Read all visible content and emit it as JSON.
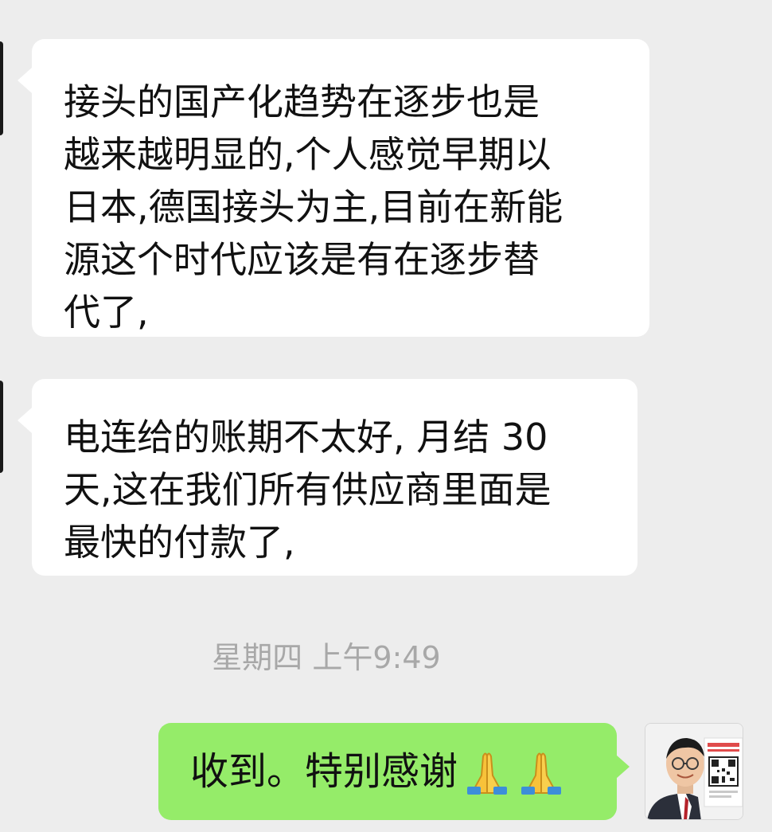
{
  "chat": {
    "messages": [
      {
        "sender": "contact",
        "lines": [
          "接头的国产化趋势在逐步也是",
          "越来越明显的,个人感觉早期以",
          "日本,德国接头为主,目前在新能",
          "源这个时代应该是有在逐步替",
          "代了,"
        ]
      },
      {
        "sender": "contact",
        "lines": [
          "电连给的账期不太好, 月结 30",
          "天,这在我们所有供应商里面是",
          "最快的付款了,"
        ]
      }
    ],
    "timestamp": "星期四 上午9:49",
    "reply": {
      "sender": "self",
      "text": "收到。特别感谢",
      "emoji": [
        "pray-icon",
        "pray-icon"
      ]
    }
  },
  "colors": {
    "background": "#ededed",
    "incoming_bubble": "#ffffff",
    "outgoing_bubble": "#95ec69",
    "timestamp_text": "#a8a8a8"
  }
}
